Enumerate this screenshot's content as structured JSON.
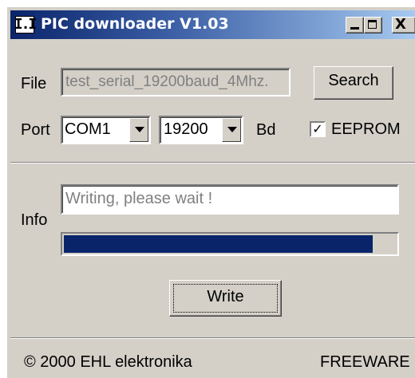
{
  "window": {
    "title": "PIC downloader V1.03",
    "icon_glyph": "I.I",
    "title_buttons": {
      "minimize": "minimize-icon",
      "maximize": "maximize-icon",
      "close": "close-icon"
    },
    "close_glyph": "X"
  },
  "file": {
    "label": "File",
    "value": "test_serial_19200baud_4Mhz.",
    "search_label": "Search"
  },
  "port": {
    "label": "Port",
    "port_value": "COM1",
    "baud_value": "19200",
    "baud_unit": "Bd",
    "eeprom_label": "EEPROM",
    "eeprom_checked": true,
    "check_glyph": "✓"
  },
  "info": {
    "label": "Info",
    "message": "Writing, please wait !",
    "progress": 0.93,
    "progress_color": "#0a246a"
  },
  "actions": {
    "write_label": "Write"
  },
  "footer": {
    "copyright": "© 2000 EHL elektronika",
    "license": "FREEWARE"
  },
  "colors": {
    "face": "#d4d0c8",
    "title_start": "#0a246a",
    "title_end": "#a6caf0",
    "text_disabled": "#808080"
  }
}
